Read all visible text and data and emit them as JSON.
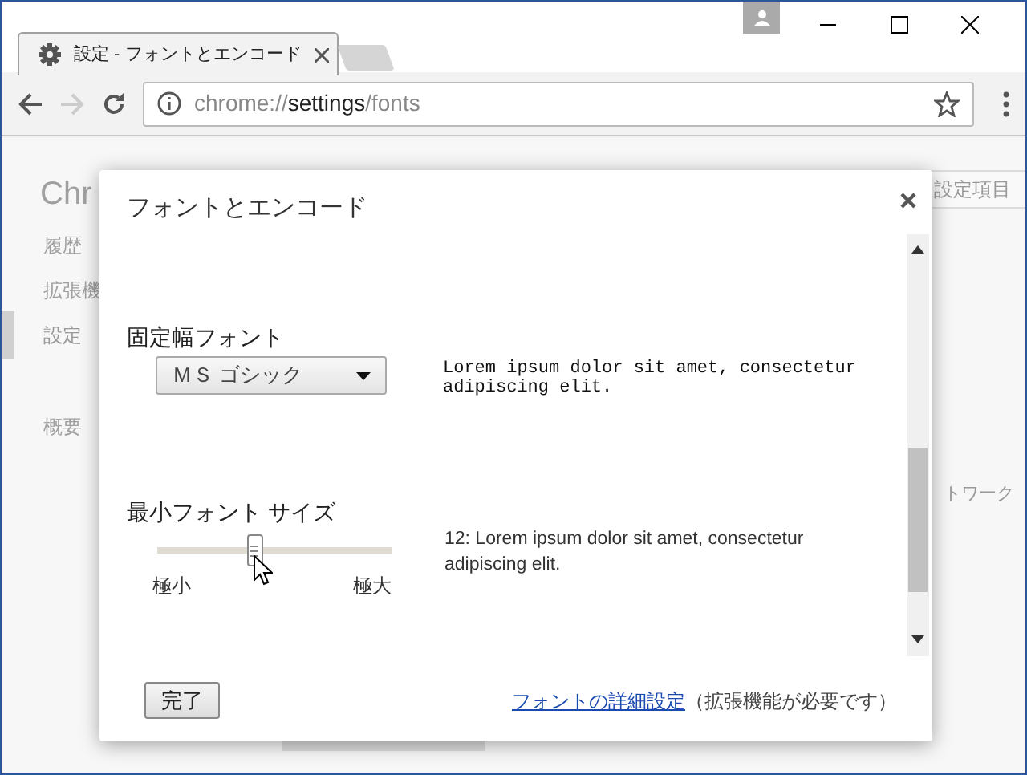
{
  "tab": {
    "title": "設定 - フォントとエンコード",
    "selected": true
  },
  "address": {
    "scheme": "chrome://",
    "host": "settings",
    "path": "/fonts"
  },
  "page": {
    "title": "Chr",
    "nav": [
      {
        "label": "履歴",
        "selected": false
      },
      {
        "label": "拡張機",
        "selected": false
      },
      {
        "label": "設定",
        "selected": true
      },
      {
        "label": "概要",
        "selected": false
      }
    ],
    "search_placeholder": "設定項目",
    "partial_text": "トワーク"
  },
  "dialog": {
    "title": "フォントとエンコード",
    "fixed_font": {
      "heading": "固定幅フォント",
      "value": "ＭＳ ゴシック",
      "sample": "Lorem ipsum dolor sit amet, consectetur adipiscing elit."
    },
    "minimum_size": {
      "heading": "最小フォント サイズ",
      "level": 0.41,
      "min_label": "極小",
      "max_label": "極大",
      "sample": "12: Lorem ipsum dolor sit amet, consectetur adipiscing elit."
    },
    "done_button": "完了",
    "link": "フォントの詳細設定",
    "note": "（拡張機能が必要です）"
  }
}
